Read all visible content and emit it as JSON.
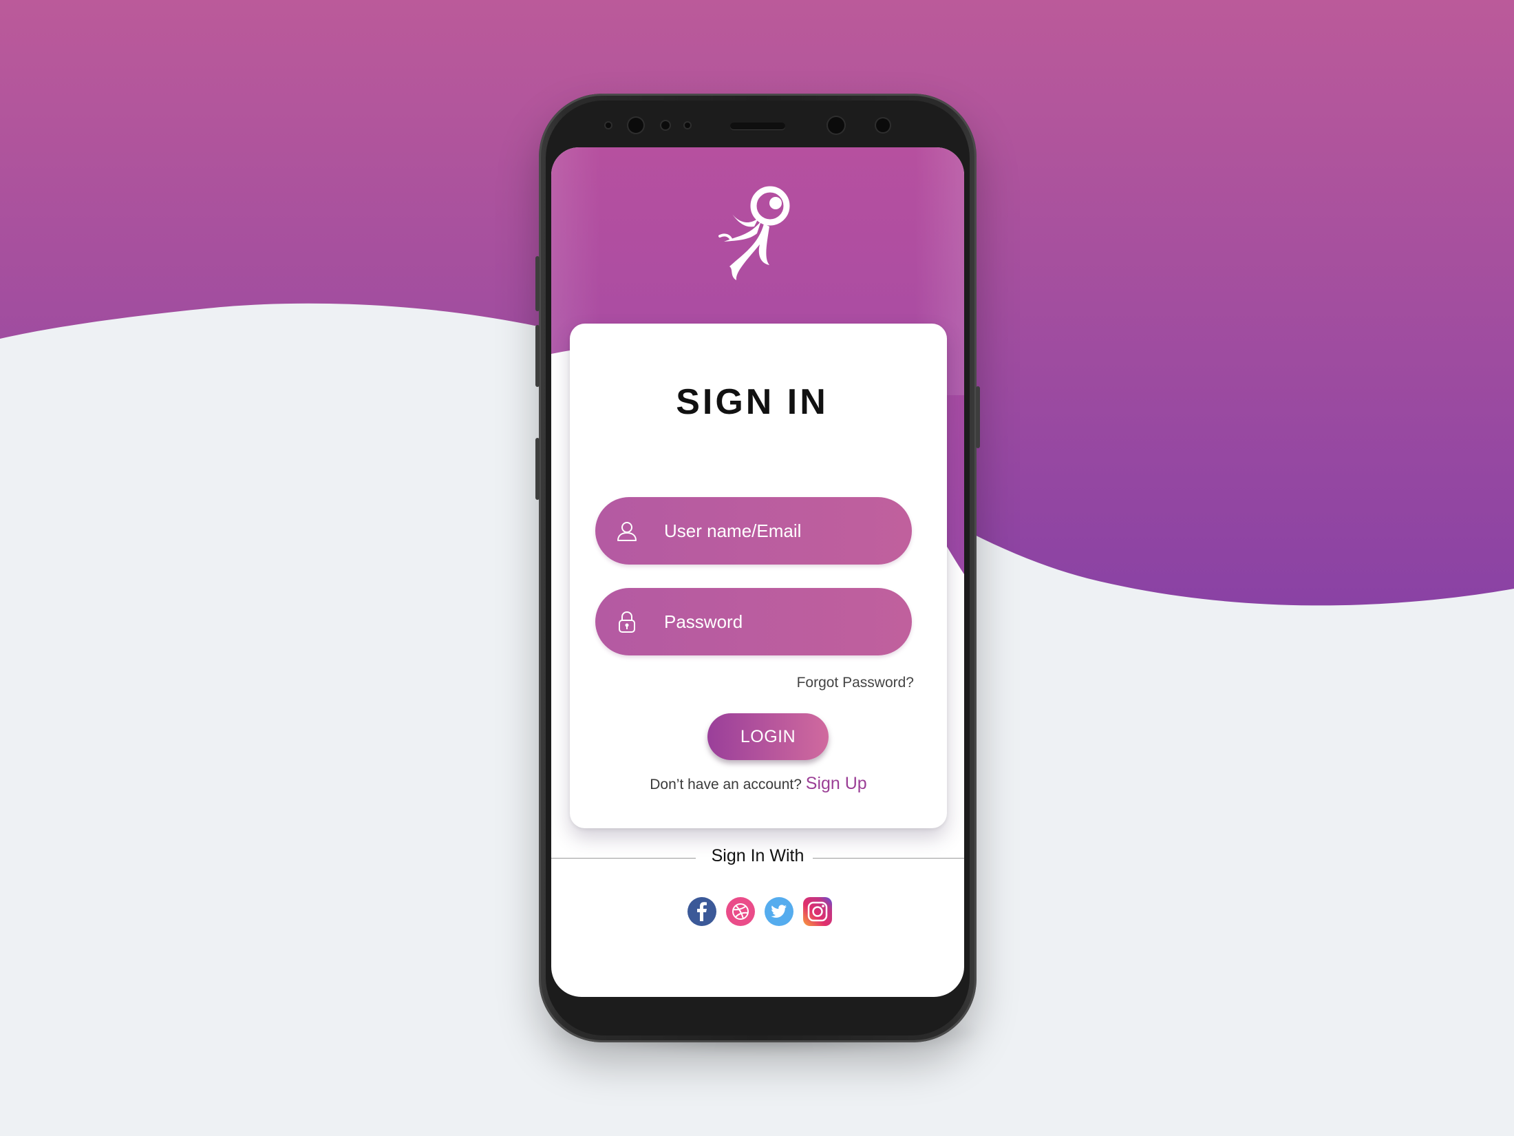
{
  "app": {
    "title": "SIGN IN"
  },
  "form": {
    "username_placeholder": "User name/Email",
    "password_placeholder": "Password",
    "forgot_label": "Forgot Password?",
    "login_label": "LOGIN",
    "signup_prompt": "Don’t have an account?",
    "signup_label": "Sign Up"
  },
  "social": {
    "heading": "Sign In With",
    "items": [
      {
        "name": "facebook-icon",
        "color": "#3b5998"
      },
      {
        "name": "dribbble-icon",
        "color": "#ea4c89"
      },
      {
        "name": "twitter-icon",
        "color": "#55acee"
      },
      {
        "name": "instagram-icon",
        "color": "#c13584"
      }
    ]
  },
  "colors": {
    "brand_pink": "#c0609d",
    "brand_purple": "#8e44a6",
    "background": "#eef1f4",
    "link": "#9b3f96"
  }
}
